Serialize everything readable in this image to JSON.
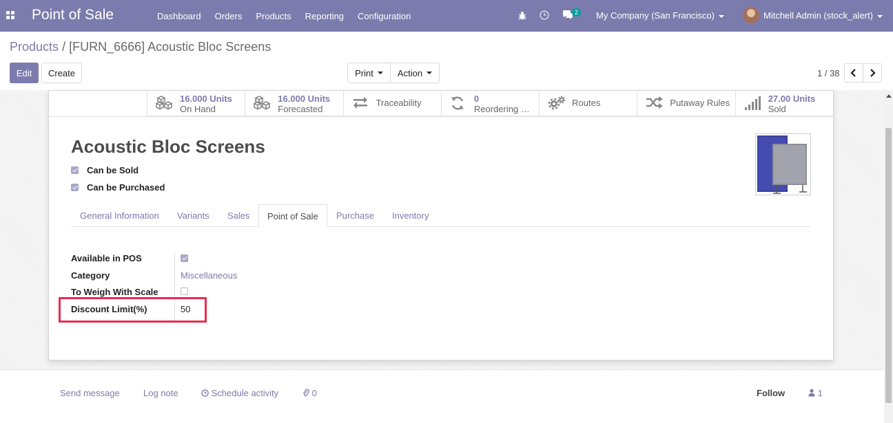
{
  "navbar": {
    "app_title": "Point of Sale",
    "menu": [
      "Dashboard",
      "Orders",
      "Products",
      "Reporting",
      "Configuration"
    ],
    "messages_count": "2",
    "company": "My Company (San Francisco)",
    "user": "Mitchell Admin (stock_alert)"
  },
  "breadcrumb": {
    "parent": "Products",
    "separator": "/",
    "current": "[FURN_6666] Acoustic Bloc Screens"
  },
  "toolbar": {
    "edit": "Edit",
    "create": "Create",
    "print": "Print",
    "action": "Action",
    "pager": "1 / 38"
  },
  "stat_buttons": [
    {
      "value": "16.000 Units",
      "label": "On Hand",
      "icon": "cubes-icon"
    },
    {
      "value": "16.000 Units",
      "label": "Forecasted",
      "icon": "cubes-icon"
    },
    {
      "value": "",
      "label": "Traceability",
      "icon": "exchange-icon"
    },
    {
      "value": "0",
      "label": "Reordering …",
      "icon": "refresh-icon"
    },
    {
      "value": "",
      "label": "Routes",
      "icon": "cogs-icon"
    },
    {
      "value": "",
      "label": "Putaway Rules",
      "icon": "random-icon"
    },
    {
      "value": "27.00 Units",
      "label": "Sold",
      "icon": "signal-icon"
    }
  ],
  "product": {
    "name": "Acoustic Bloc Screens",
    "can_be_sold": "Can be Sold",
    "can_be_purchased": "Can be Purchased"
  },
  "tabs": [
    "General Information",
    "Variants",
    "Sales",
    "Point of Sale",
    "Purchase",
    "Inventory"
  ],
  "active_tab": "Point of Sale",
  "pos_fields": {
    "available_label": "Available in POS",
    "category_label": "Category",
    "category_value": "Miscellaneous",
    "scale_label": "To Weigh With Scale",
    "discount_label": "Discount Limit(%)",
    "discount_value": "50"
  },
  "chatter": {
    "send_message": "Send message",
    "log_note": "Log note",
    "schedule_activity": "Schedule activity",
    "attachments": "0",
    "follow": "Follow",
    "followers": "1"
  },
  "colors": {
    "brand": "#7c7bad",
    "highlight": "#e8294f",
    "badge": "#00a09d"
  }
}
